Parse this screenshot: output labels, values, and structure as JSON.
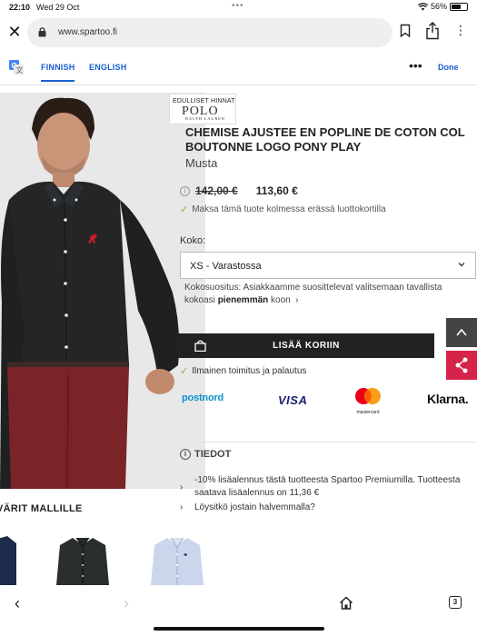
{
  "status_bar": {
    "time": "22:10",
    "date": "Wed 29 Oct",
    "battery": "56%",
    "battery_level": 0.56
  },
  "browser": {
    "url": "www.spartoo.fi"
  },
  "translate_bar": {
    "lang_active": "FINNISH",
    "lang_other": "ENGLISH",
    "more": "•••",
    "done": "Done"
  },
  "brand": {
    "badge": "EDULLISET HINNAT",
    "word": "POLO",
    "sub": "RALPH LAUREN"
  },
  "product": {
    "title": "CHEMISE AJUSTEE EN POPLINE DE COTON COL BOUTONNE LOGO PONY PLAY",
    "color": "Musta",
    "old_price": "142,00 €",
    "new_price": "113,60 €",
    "installments": "Maksa tämä tuote kolmessa erässä luottokortilla"
  },
  "size": {
    "label": "Koko:",
    "selected": "XS -  Varastossa",
    "advice_prefix": "Kokosuositus: Asiakkaamme suosittelevat valitsemaan tavallista kokoasi",
    "advice_bold": "pienemmän",
    "advice_suffix": "koon"
  },
  "cart": {
    "label": "LISÄÄ KORIIN"
  },
  "shipping": {
    "text": "Ilmainen toimitus ja palautus"
  },
  "payment_logos": {
    "postnord": "postnord",
    "visa": "VISA",
    "mastercard": "mastercard",
    "klarna": "Klarna."
  },
  "details": {
    "header": "TIEDOT",
    "items": [
      "-10% lisäalennus tästä tuotteesta Spartoo Premiumilla. Tuotteesta saatava lisäalennus on 11,36 €",
      "Löysitkö jostain halvemmalla?"
    ]
  },
  "colors_section": {
    "heading": "VÄRIT MALLILLE"
  },
  "toolbar": {
    "tab_count": "3"
  }
}
